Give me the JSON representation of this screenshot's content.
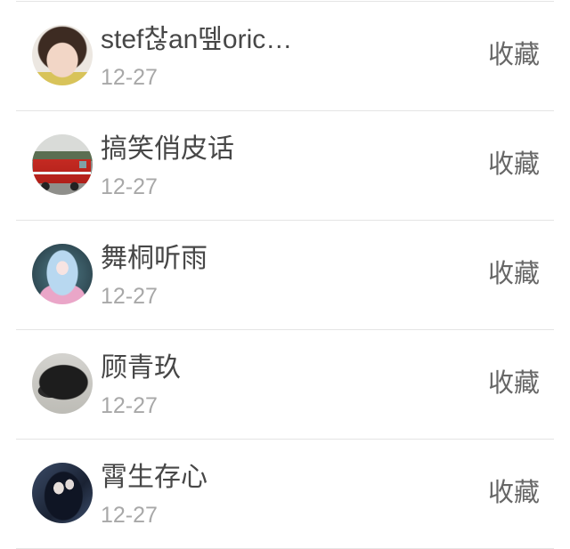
{
  "list": {
    "items": [
      {
        "name": "stef찮an뗖oric…",
        "date": "12-27",
        "action": "收藏"
      },
      {
        "name": "搞笑俏皮话",
        "date": "12-27",
        "action": "收藏"
      },
      {
        "name": "舞桐听雨",
        "date": "12-27",
        "action": "收藏"
      },
      {
        "name": "顾青玖",
        "date": "12-27",
        "action": "收藏"
      },
      {
        "name": "霄生存心",
        "date": "12-27",
        "action": "收藏"
      }
    ]
  },
  "colors": {
    "name_text": "#474747",
    "date_text": "#a8a8a8",
    "action_text": "#676767",
    "divider": "#e4e4e4",
    "background": "#ffffff"
  }
}
